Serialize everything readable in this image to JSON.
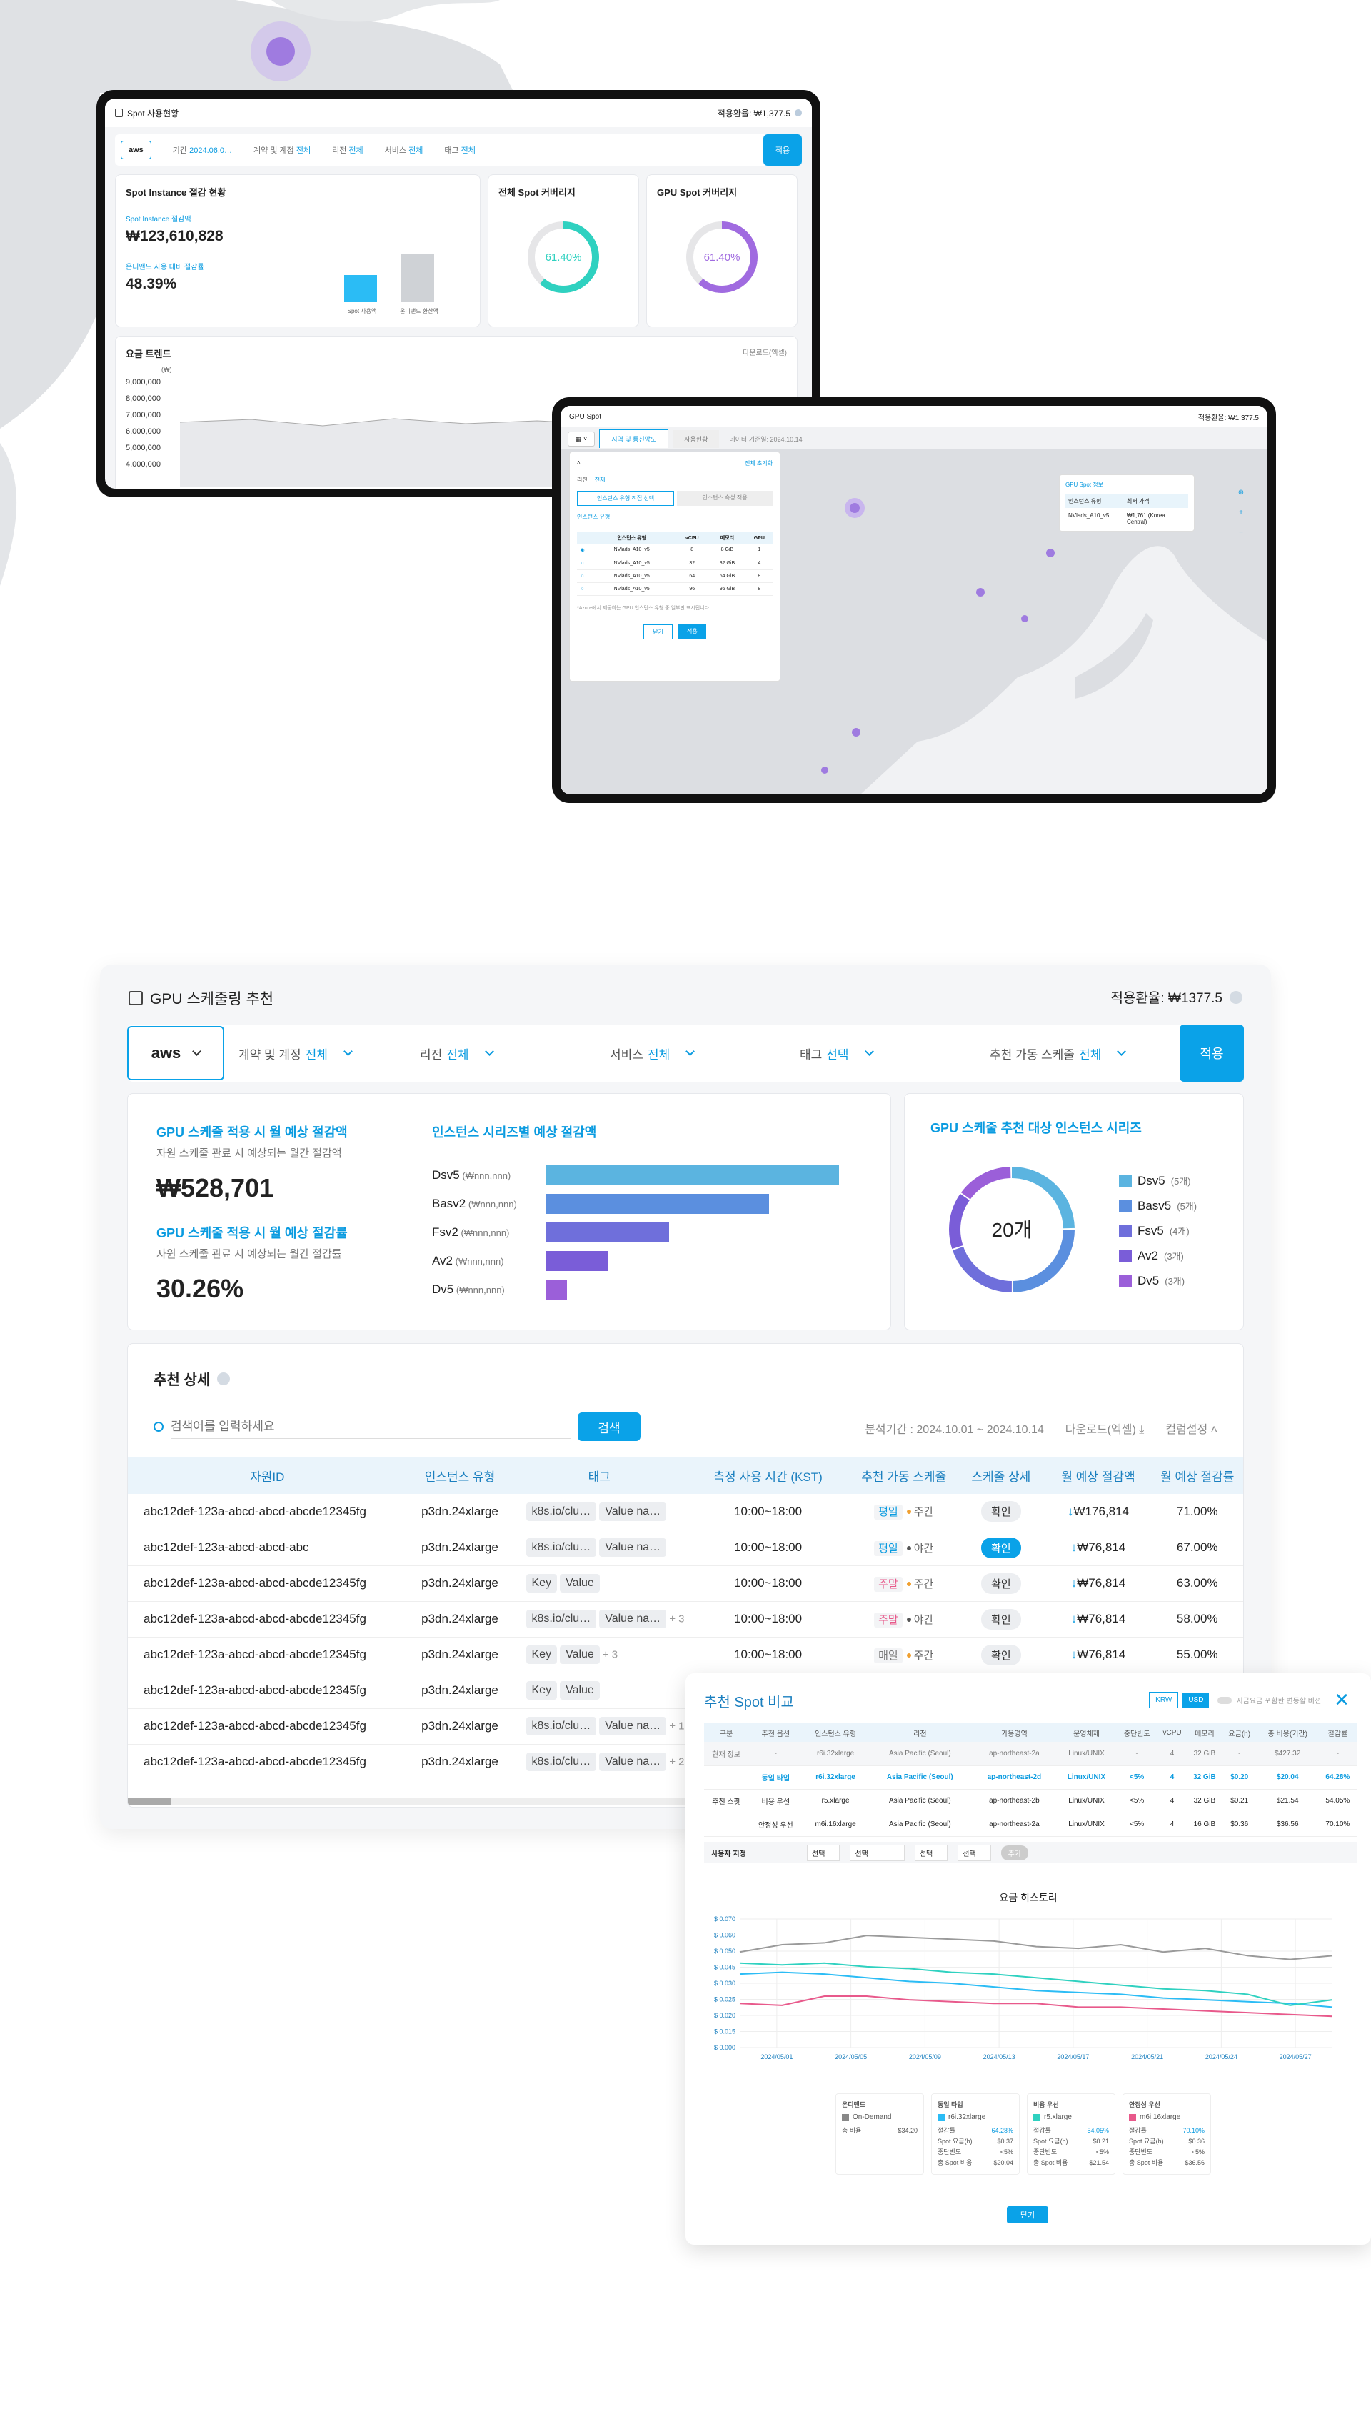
{
  "top_device": {
    "title": "Spot 사용현황",
    "rate": "적용환율: ₩1,377.5",
    "filters": {
      "cloud": "aws",
      "period_label": "기간",
      "period_value": "2024.06.0…",
      "account_label": "계약 및 계정",
      "account_value": "전체",
      "region_label": "리전",
      "region_value": "전체",
      "service_label": "서비스",
      "service_value": "전체",
      "tag_label": "태그",
      "tag_value": "전체",
      "apply": "적용"
    },
    "savings": {
      "title": "Spot Instance 절감 현황",
      "amount_label": "Spot Instance 절감액",
      "amount": "₩123,610,828",
      "rate_label": "온디맨드 사용 대비 절감률",
      "rate": "48.39%",
      "bars": [
        {
          "label": "Spot 사용액",
          "value": 0.35,
          "color": "#2bbcf5"
        },
        {
          "label": "온디맨드 환산액",
          "value": 0.62,
          "color": "#cfd2d6"
        }
      ]
    },
    "cov_all": {
      "title": "전체 Spot 커버리지",
      "value": "61.40%",
      "percent": 61.4,
      "color": "#2fd1c0"
    },
    "cov_gpu": {
      "title": "GPU Spot 커버리지",
      "value": "61.40%",
      "percent": 61.4,
      "color": "#a06be0"
    },
    "trend": {
      "title": "요금 트렌드",
      "download": "다운로드(엑셀)",
      "unit": "(₩)",
      "ticks": [
        "9,000,000",
        "8,000,000",
        "7,000,000",
        "6,000,000",
        "5,000,000",
        "4,000,000"
      ]
    }
  },
  "gpu_device": {
    "title": "GPU Spot",
    "rate": "적용환율: ₩1,377.5",
    "tabs": [
      "지역 및 통신망도",
      "사용현황"
    ],
    "notice": "데이터 기준일: 2024.10.14",
    "panel": {
      "reset": "전체 초기화",
      "region_label": "리전",
      "region_value": "전체",
      "type_tabs": [
        "인스턴스 유형 직접 선택",
        "인스턴스 속성 적용"
      ],
      "search_label": "인스턴스 유형",
      "headers": [
        "인스턴스 유형",
        "vCPU",
        "메모리",
        "GPU"
      ],
      "rows": [
        [
          "NVlads_A10_v5",
          "8",
          "8 GiB",
          "1"
        ],
        [
          "NVlads_A10_v5",
          "32",
          "32 GiB",
          "4"
        ],
        [
          "NVlads_A10_v5",
          "64",
          "64 GiB",
          "8"
        ],
        [
          "NVlads_A10_v5",
          "96",
          "96 GiB",
          "8"
        ]
      ],
      "note": "*Azure에서 제공하는 GPU 인스턴스 유형 중 일부만 표시됩니다",
      "close": "닫기",
      "apply": "적용"
    },
    "popup": {
      "title": "GPU Spot 정보",
      "headers": [
        "인스턴스 유형",
        "최저 가격"
      ],
      "row": [
        "NVlads_A10_v5",
        "₩1,761 (Korea Central)"
      ]
    }
  },
  "main": {
    "title": "GPU 스케줄링 추천",
    "rate": "적용환율: ₩1377.5",
    "filters": {
      "cloud": "aws",
      "account_label": "계약 및 계정",
      "account_value": "전체",
      "region_label": "리전",
      "region_value": "전체",
      "service_label": "서비스",
      "service_value": "전체",
      "tag_label": "태그",
      "tag_value": "선택",
      "schedule_label": "추천 가동 스케줄",
      "schedule_value": "전체",
      "apply": "적용"
    },
    "summary": {
      "monthly_title": "GPU 스케줄 적용 시 월 예상 절감액",
      "monthly_sub": "자원 스케줄 관료 시 예상되는 월간 절감액",
      "monthly_value": "₩528,701",
      "rate_title": "GPU 스케줄 적용 시 월 예상 절감률",
      "rate_sub": "자원 스케줄 관료 시 예상되는 월간 절감률",
      "rate_value": "30.26%"
    },
    "series_chart": {
      "title": "인스턴스 시리즈별 예상 절감액"
    },
    "donut": {
      "title": "GPU 스케줄 추천 대상 인스턴스 시리즈",
      "center": "20개"
    },
    "detail": {
      "title": "추천 상세",
      "search_placeholder": "검색어를 입력하세요",
      "search_btn": "검색",
      "period": "분석기간 : 2024.10.01 ~ 2024.10.14",
      "download": "다운로드(엑셀)",
      "columns_btn": "컬럼설정",
      "headers": [
        "자원ID",
        "인스턴스 유형",
        "태그",
        "측정 사용 시간 (KST)",
        "추천 가동 스케줄",
        "스케줄 상세",
        "월 예상 절감액",
        "월 예상 절감률"
      ],
      "rows": [
        {
          "id": "abc12def-123a-abcd-abcd-abcde12345fg",
          "type": "p3dn.24xlarge",
          "tags": [
            "k8s.io/clu…",
            "Value na…"
          ],
          "more": "",
          "time": "10:00~18:00",
          "day": "평일",
          "day_kind": "wd",
          "slot": "주간",
          "slot_color": "#f0a030",
          "btn": "확인",
          "btn_on": false,
          "save": "₩176,814",
          "rate": "71.00%"
        },
        {
          "id": "abc12def-123a-abcd-abcd-abc",
          "type": "p3dn.24xlarge",
          "tags": [
            "k8s.io/clu…",
            "Value na…"
          ],
          "more": "",
          "time": "10:00~18:00",
          "day": "평일",
          "day_kind": "wd",
          "slot": "야간",
          "slot_color": "#555",
          "btn": "확인",
          "btn_on": true,
          "save": "₩76,814",
          "rate": "67.00%"
        },
        {
          "id": "abc12def-123a-abcd-abcd-abcde12345fg",
          "type": "p3dn.24xlarge",
          "tags": [
            "Key",
            "Value"
          ],
          "more": "",
          "time": "10:00~18:00",
          "day": "주말",
          "day_kind": "we",
          "slot": "주간",
          "slot_color": "#f0a030",
          "btn": "확인",
          "btn_on": false,
          "save": "₩76,814",
          "rate": "63.00%"
        },
        {
          "id": "abc12def-123a-abcd-abcd-abcde12345fg",
          "type": "p3dn.24xlarge",
          "tags": [
            "k8s.io/clu…",
            "Value na…"
          ],
          "more": "+ 3",
          "time": "10:00~18:00",
          "day": "주말",
          "day_kind": "we",
          "slot": "야간",
          "slot_color": "#555",
          "btn": "확인",
          "btn_on": false,
          "save": "₩76,814",
          "rate": "58.00%"
        },
        {
          "id": "abc12def-123a-abcd-abcd-abcde12345fg",
          "type": "p3dn.24xlarge",
          "tags": [
            "Key",
            "Value"
          ],
          "more": "+ 3",
          "time": "10:00~18:00",
          "day": "매일",
          "day_kind": "ev",
          "slot": "주간",
          "slot_color": "#f0a030",
          "btn": "확인",
          "btn_on": false,
          "save": "₩76,814",
          "rate": "55.00%"
        },
        {
          "id": "abc12def-123a-abcd-abcd-abcde12345fg",
          "type": "p3dn.24xlarge",
          "tags": [
            "Key",
            "Value"
          ],
          "more": "",
          "time": "",
          "day": "",
          "day_kind": "",
          "slot": "",
          "slot_color": "",
          "btn": "",
          "btn_on": false,
          "save": "",
          "rate": ""
        },
        {
          "id": "abc12def-123a-abcd-abcd-abcde12345fg",
          "type": "p3dn.24xlarge",
          "tags": [
            "k8s.io/clu…",
            "Value na…"
          ],
          "more": "+ 1",
          "time": "",
          "day": "",
          "day_kind": "",
          "slot": "",
          "slot_color": "",
          "btn": "",
          "btn_on": false,
          "save": "",
          "rate": ""
        },
        {
          "id": "abc12def-123a-abcd-abcd-abcde12345fg",
          "type": "p3dn.24xlarge",
          "tags": [
            "k8s.io/clu…",
            "Value na…"
          ],
          "more": "+ 2",
          "time": "",
          "day": "",
          "day_kind": "",
          "slot": "",
          "slot_color": "",
          "btn": "",
          "btn_on": false,
          "save": "",
          "rate": ""
        }
      ]
    }
  },
  "compare": {
    "title": "추천 Spot 비교",
    "currency": [
      "KRW",
      "USD"
    ],
    "toggle_label": "지금요금 포함한 변동할 버선",
    "headers": [
      "구분",
      "추천 옵션",
      "인스턴스 유형",
      "리전",
      "가용영역",
      "운영체제",
      "중단빈도",
      "vCPU",
      "메모리",
      "요금(h)",
      "총 비용(기간)",
      "절감률"
    ],
    "rows": [
      [
        "현재 정보",
        "-",
        "r6i.32xlarge",
        "Asia Pacific (Seoul)",
        "ap-northeast-2a",
        "Linux/UNIX",
        "-",
        "4",
        "32 GiB",
        "-",
        "$427.32",
        "-"
      ],
      [
        "",
        "동일 타입",
        "r6i.32xlarge",
        "Asia Pacific (Seoul)",
        "ap-northeast-2d",
        "Linux/UNIX",
        "<5%",
        "4",
        "32 GiB",
        "$0.20",
        "$20.04",
        "64.28%"
      ],
      [
        "추천 스팟",
        "비용 우선",
        "r5.xlarge",
        "Asia Pacific (Seoul)",
        "ap-northeast-2b",
        "Linux/UNIX",
        "<5%",
        "4",
        "32 GiB",
        "$0.21",
        "$21.54",
        "54.05%"
      ],
      [
        "",
        "안정성 우선",
        "m6i.16xlarge",
        "Asia Pacific (Seoul)",
        "ap-northeast-2a",
        "Linux/UNIX",
        "<5%",
        "4",
        "16 GiB",
        "$0.36",
        "$36.56",
        "70.10%"
      ]
    ],
    "custom_label": "사용자 지정",
    "custom_selects": [
      "선택",
      "선택",
      "선택",
      "선택"
    ],
    "custom_btn": "추가",
    "history_title": "요금 히스토리",
    "legend_cards": [
      {
        "head": "온디맨드",
        "name": "On-Demand",
        "color": "#888",
        "lines": [
          [
            "총 비용",
            "$34.20"
          ]
        ]
      },
      {
        "head": "동일 타입",
        "name": "r6i.32xlarge",
        "color": "#2bbcf5",
        "lines": [
          [
            "절감률",
            "64.28%"
          ],
          [
            "Spot 요금(h)",
            "$0.37"
          ],
          [
            "중단빈도",
            "<5%"
          ],
          [
            "총 Spot 비용",
            "$20.04"
          ]
        ]
      },
      {
        "head": "비용 우선",
        "name": "r5.xlarge",
        "color": "#2fd1c0",
        "lines": [
          [
            "절감률",
            "54.05%"
          ],
          [
            "Spot 요금(h)",
            "$0.21"
          ],
          [
            "중단빈도",
            "<5%"
          ],
          [
            "총 Spot 비용",
            "$21.54"
          ]
        ]
      },
      {
        "head": "안정성 우선",
        "name": "m6i.16xlarge",
        "color": "#e8598b",
        "lines": [
          [
            "절감률",
            "70.10%"
          ],
          [
            "Spot 요금(h)",
            "$0.36"
          ],
          [
            "중단빈도",
            "<5%"
          ],
          [
            "총 Spot 비용",
            "$36.56"
          ]
        ]
      }
    ],
    "close": "닫기"
  },
  "chart_data": [
    {
      "type": "bar",
      "title": "인스턴스 시리즈별 예상 절감액",
      "categories": [
        "Dsv5",
        "Basv2",
        "Fsv2",
        "Av2",
        "Dv5"
      ],
      "category_notes": [
        "(₩nnn,nnn)",
        "(₩nnn,nnn)",
        "(₩nnn,nnn)",
        "(₩nnn,nnn)",
        "(₩nnn,nnn)"
      ],
      "values": [
        100,
        76,
        42,
        21,
        7
      ],
      "colors": [
        "#5bb4e0",
        "#5b8fdf",
        "#6f6fdb",
        "#7a5dd8",
        "#9b5fd9"
      ]
    },
    {
      "type": "pie",
      "title": "GPU 스케줄 추천 대상 인스턴스 시리즈",
      "center": "20개",
      "labels": [
        "Dsv5",
        "Basv5",
        "Fsv5",
        "Av2",
        "Dv5"
      ],
      "notes": [
        "(5개)",
        "(5개)",
        "(4개)",
        "(3개)",
        "(3개)"
      ],
      "values": [
        5,
        5,
        4,
        3,
        3
      ],
      "colors": [
        "#5bb4e0",
        "#5b8fdf",
        "#6f6fdb",
        "#7a5dd8",
        "#9b5fd9"
      ]
    },
    {
      "type": "line",
      "title": "요금 히스토리",
      "x": [
        "2024/05/01",
        "2024/05/05",
        "2024/05/09",
        "2024/05/13",
        "2024/05/17",
        "2024/05/21",
        "2024/05/24",
        "2024/05/27"
      ],
      "y_ticks": [
        "$ 0.070",
        "$ 0.060",
        "$ 0.050",
        "$ 0.045",
        "$ 0.030",
        "$ 0.025",
        "$ 0.020",
        "$ 0.015",
        "$ 0.000"
      ],
      "ylim": [
        0,
        0.07
      ],
      "series": [
        {
          "name": "On-Demand",
          "color": "#9a9a9a",
          "values": [
            0.052,
            0.056,
            0.057,
            0.061,
            0.06,
            0.059,
            0.058,
            0.055,
            0.054,
            0.056,
            0.052,
            0.054,
            0.05,
            0.048,
            0.05
          ]
        },
        {
          "name": "r6i.32xlarge",
          "color": "#2bbcf5",
          "values": [
            0.04,
            0.041,
            0.04,
            0.038,
            0.036,
            0.035,
            0.033,
            0.031,
            0.03,
            0.029,
            0.027,
            0.026,
            0.025,
            0.024,
            0.022
          ]
        },
        {
          "name": "r5.xlarge",
          "color": "#2fd1c0",
          "values": [
            0.046,
            0.045,
            0.046,
            0.044,
            0.043,
            0.041,
            0.04,
            0.038,
            0.036,
            0.034,
            0.032,
            0.031,
            0.029,
            0.023,
            0.026
          ]
        },
        {
          "name": "m6i.16xlarge",
          "color": "#e8598b",
          "values": [
            0.024,
            0.023,
            0.028,
            0.028,
            0.026,
            0.025,
            0.024,
            0.024,
            0.022,
            0.022,
            0.021,
            0.02,
            0.019,
            0.018,
            0.017
          ]
        }
      ]
    }
  ]
}
